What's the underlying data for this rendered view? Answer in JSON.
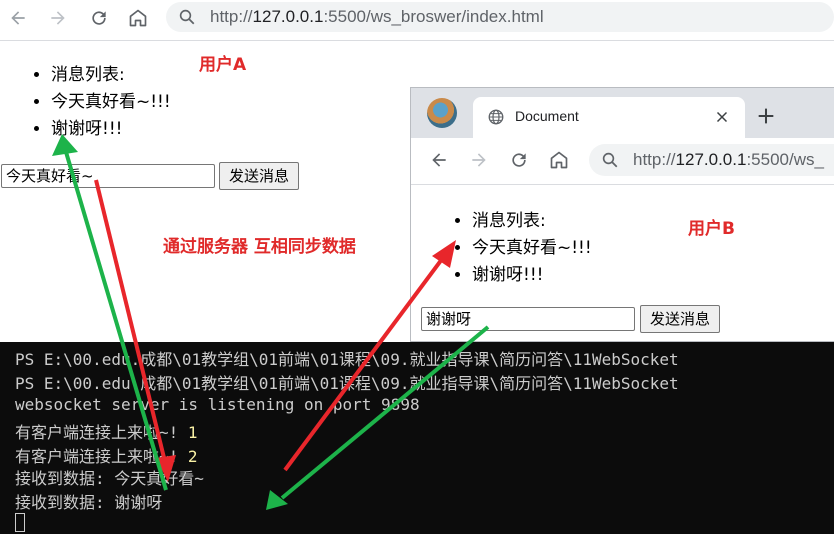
{
  "browser_a": {
    "url_prefix": "http://",
    "url_host": "127.0.0.1",
    "url_rest": ":5500/ws_broswer/index.html",
    "messages": [
      "消息列表:",
      "今天真好看~!!!",
      "谢谢呀!!!"
    ],
    "input_value": "今天真好看~",
    "send_button": "发送消息",
    "user_label": "用户A"
  },
  "browser_b": {
    "tab_title": "Document",
    "url_prefix": "http://",
    "url_host": "127.0.0.1",
    "url_rest": ":5500/ws_",
    "messages": [
      "消息列表:",
      "今天真好看~!!!",
      "谢谢呀!!!"
    ],
    "input_value": "谢谢呀",
    "send_button": "发送消息",
    "user_label": "用户B"
  },
  "annotation": {
    "middle_label": "通过服务器 互相同步数据",
    "arrow_colors": {
      "red": "#e8262b",
      "green": "#1db34a"
    }
  },
  "terminal": {
    "lines": [
      "PS E:\\00.edu.成都\\01教学组\\01前端\\01课程\\09.就业指导课\\简历问答\\11WebSocket",
      "PS E:\\00.edu.成都\\01教学组\\01前端\\01课程\\09.就业指导课\\简历问答\\11WebSocket",
      "websocket server is listening on port 9898"
    ],
    "connect_lines": [
      {
        "text": "有客户端连接上来啦~!",
        "count": "1"
      },
      {
        "text": "有客户端连接上来啦~!",
        "count": "2"
      }
    ],
    "receive_lines": [
      "接收到数据: 今天真好看~",
      "接收到数据: 谢谢呀"
    ]
  }
}
